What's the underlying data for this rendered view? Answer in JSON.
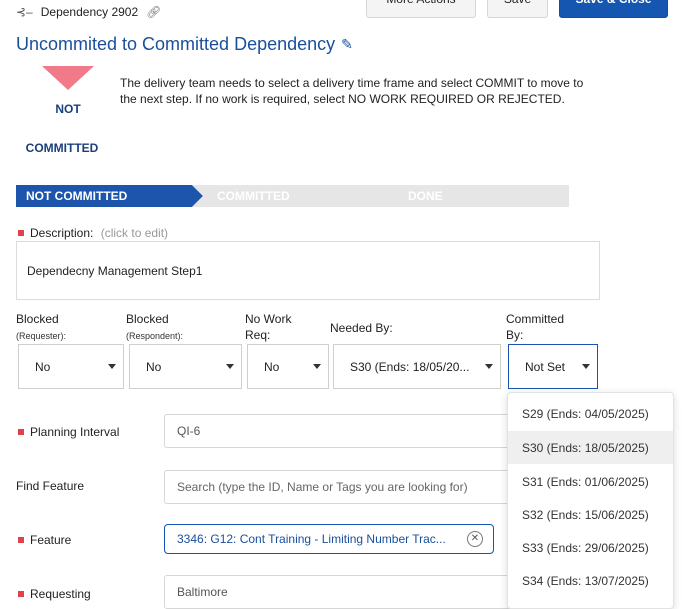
{
  "header": {
    "breadcrumb_label": "Dependency 2902",
    "title": "Uncommited to Committed Dependency",
    "buttons": {
      "more_actions": "More Actions",
      "save": "Save",
      "save_close": "Save & Close"
    }
  },
  "status": {
    "badge_top": "NOT",
    "badge_bottom": "COMMITTED",
    "message": "The delivery team needs to select a delivery time frame and select COMMIT to move to the next step. If no work is required, select NO WORK REQUIRED OR REJECTED."
  },
  "steps": [
    "NOT COMMITTED",
    "COMMITTED",
    "DONE"
  ],
  "description": {
    "label": "Description:",
    "hint": "(click to edit)",
    "value": "Dependecny Management Step1"
  },
  "selectors": {
    "blocked_req": {
      "label": "Blocked",
      "sub": "(Requester):",
      "value": "No"
    },
    "blocked_resp": {
      "label": "Blocked",
      "sub": "(Respondent):",
      "value": "No"
    },
    "no_work": {
      "label_line1": "No Work",
      "label_line2": "Req:",
      "value": "No"
    },
    "needed_by": {
      "label": "Needed By:",
      "value": "S30 (Ends: 18/05/20..."
    },
    "committed_by": {
      "label_line1": "Committed",
      "label_line2": "By:",
      "value": "Not Set"
    }
  },
  "form": {
    "planning_interval": {
      "label": "Planning Interval",
      "value": "QI-6"
    },
    "find_feature": {
      "label": "Find Feature",
      "placeholder": "Search (type the ID, Name or Tags you are looking for)"
    },
    "feature": {
      "label": "Feature",
      "value": "3346: G12: Cont Training - Limiting Number Trac..."
    },
    "requesting": {
      "label": "Requesting",
      "value": "Baltimore"
    }
  },
  "dropdown_options": [
    "S29 (Ends: 04/05/2025)",
    "S30 (Ends: 18/05/2025)",
    "S31 (Ends: 01/06/2025)",
    "S32 (Ends: 15/06/2025)",
    "S33 (Ends: 29/06/2025)",
    "S34 (Ends: 13/07/2025)"
  ],
  "colors": {
    "accent": "#1a4f9c",
    "primary_button": "#1557b0",
    "required": "#e0424d",
    "badge": "#f07a8a"
  }
}
